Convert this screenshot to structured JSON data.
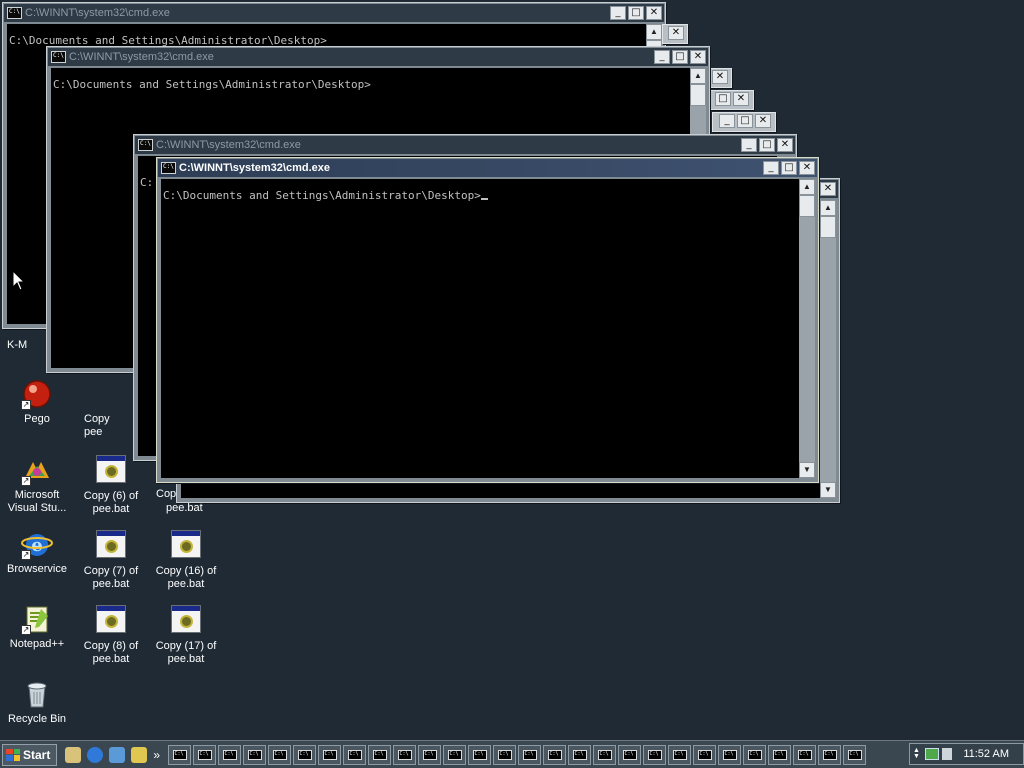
{
  "windows": {
    "back1": {
      "title": "C:\\WINNT\\system32\\cmd.exe",
      "text": "C:\\Documents and Settings\\Administrator\\Desktop>"
    },
    "back2": {
      "title": "C:\\WINNT\\system32\\cmd.exe",
      "text": "C:\\Documents and Settings\\Administrator\\Desktop>"
    },
    "back3": {
      "title": "C:\\WINNT\\system32\\cmd.exe",
      "text": "C:"
    },
    "front": {
      "title": "C:\\WINNT\\system32\\cmd.exe",
      "text": "C:\\Documents and Settings\\Administrator\\Desktop>"
    },
    "icon_label": "C:\\",
    "min_glyph": "_",
    "max_glyph": "□",
    "close_glyph": "✕"
  },
  "desktop": {
    "partial_label": "K-M",
    "icons": [
      {
        "label": "Pego",
        "icon": "red-ball-icon"
      },
      {
        "label": "Microsoft Visual Stu...",
        "icon": "visual-studio-icon"
      },
      {
        "label": "Browservice",
        "icon": "internet-explorer-icon"
      },
      {
        "label": "Notepad++",
        "icon": "notepad-plus-plus-icon"
      },
      {
        "label": "Recycle Bin",
        "icon": "recycle-bin-icon"
      },
      {
        "label": "Copy (6) of pee.bat",
        "icon": "batch-file-icon"
      },
      {
        "label": "Copy (7) of pee.bat",
        "icon": "batch-file-icon"
      },
      {
        "label": "Copy (8) of pee.bat",
        "icon": "batch-file-icon"
      },
      {
        "label": "Copy (16) of pee.bat",
        "icon": "batch-file-icon"
      },
      {
        "label": "Copy (17) of pee.bat",
        "icon": "batch-file-icon"
      }
    ],
    "partial_icons": [
      {
        "label": "Copy pee"
      },
      {
        "label": "Cop"
      },
      {
        "label": "pee.bat"
      }
    ]
  },
  "taskbar": {
    "start_label": "Start",
    "quick_launch_more": "»",
    "task_button_count": 28,
    "clock": "11:52 AM",
    "colors": {
      "taskbar": "#3a4650",
      "desktop": "#1f2a35"
    }
  }
}
